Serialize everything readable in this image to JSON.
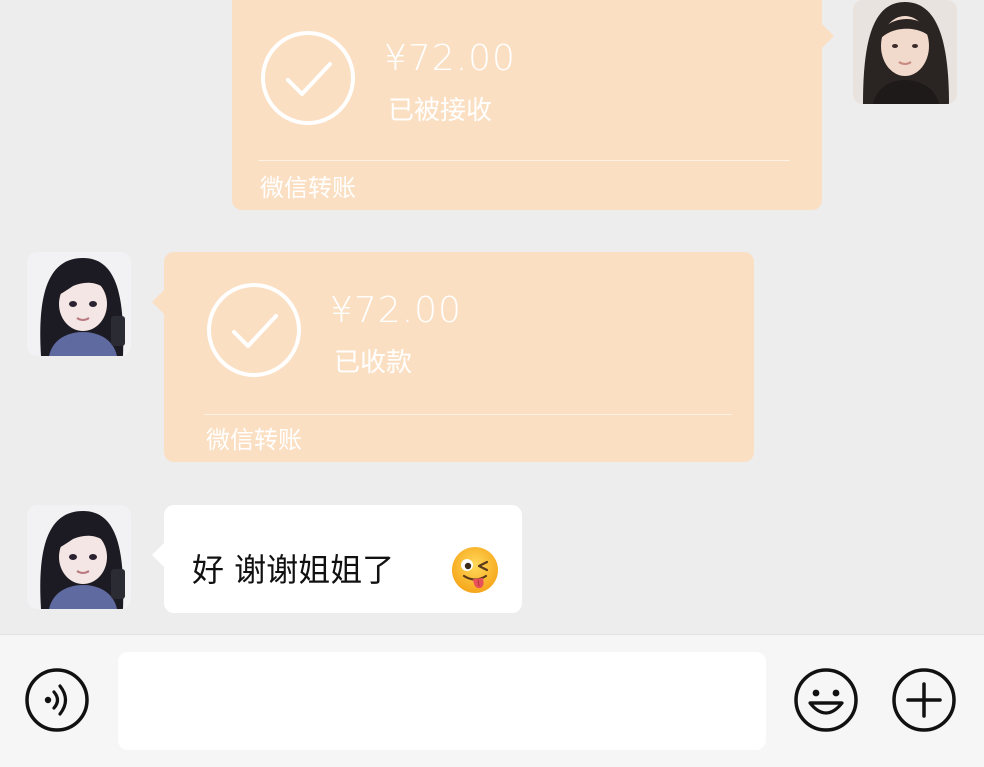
{
  "messages": [
    {
      "side": "right",
      "type": "transfer",
      "amount": "¥72.00",
      "status": "已被接收",
      "footer": "微信转账"
    },
    {
      "side": "left",
      "type": "transfer",
      "amount": "¥72.00",
      "status": "已收款",
      "footer": "微信转账"
    },
    {
      "side": "left",
      "type": "text",
      "text": "好 谢谢姐姐了",
      "emoji": "winking-face-tongue"
    }
  ],
  "input_bar": {
    "voice_icon": "voice-icon",
    "emoji_icon": "emoji-icon",
    "plus_icon": "plus-icon",
    "value": ""
  },
  "colors": {
    "background": "#ededed",
    "transfer_bubble": "#fbdfc3",
    "text_bubble": "#ffffff",
    "input_bar": "#f6f6f6"
  }
}
